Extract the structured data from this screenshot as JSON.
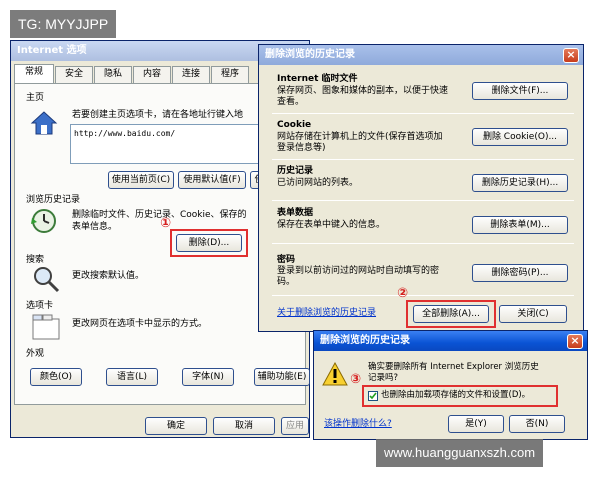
{
  "watermark": {
    "tag": "TG: MYYJJPP",
    "site": "www.huangguanxszh.com"
  },
  "inet": {
    "title": "Internet 选项",
    "tabs": [
      "常规",
      "安全",
      "隐私",
      "内容",
      "连接",
      "程序"
    ],
    "home": {
      "section": "主页",
      "desc": "若要创建主页选项卡，请在各地址行键入地",
      "url": "http://www.baidu.com/",
      "use_current": "使用当前页(C)",
      "use_default": "使用默认值(F)",
      "use_blank": "使"
    },
    "history": {
      "section": "浏览历史记录",
      "desc1": "删除临时文件、历史记录、Cookie、保存的",
      "desc2": "表单信息。",
      "delete_btn": "删除(D)..."
    },
    "search": {
      "section": "搜索",
      "desc": "更改搜索默认值。"
    },
    "tabs_sec": {
      "section": "选项卡",
      "desc": "更改网页在选项卡中显示的方式。"
    },
    "appearance": {
      "section": "外观",
      "buttons": [
        "颜色(O)",
        "语言(L)",
        "字体(N)",
        "辅助功能(E)"
      ]
    },
    "footer": {
      "ok": "确定",
      "cancel": "取消",
      "apply": "应用"
    }
  },
  "del": {
    "title": "删除浏览的历史记录",
    "rows": [
      {
        "title": "Internet 临时文件",
        "desc1": "保存网页、图象和媒体的副本，以便于快速",
        "desc2": "查看。",
        "btn": "删除文件(F)..."
      },
      {
        "title": "Cookie",
        "desc1": "网站存储在计算机上的文件(保存首选项加",
        "desc2": "登录信息等)",
        "btn": "删除 Cookie(O)..."
      },
      {
        "title": "历史记录",
        "desc1": "已访问网站的列表。",
        "desc2": "",
        "btn": "删除历史记录(H)..."
      },
      {
        "title": "表单数据",
        "desc1": "保存在表单中键入的信息。",
        "desc2": "",
        "btn": "删除表单(M)..."
      },
      {
        "title": "密码",
        "desc1": "登录到以前访问过的网站时自动填写的密",
        "desc2": "码。",
        "btn": "删除密码(P)..."
      }
    ],
    "about_link": "关于删除浏览的历史记录",
    "delete_all": "全部删除(A)...",
    "close": "关闭(C)"
  },
  "confirm": {
    "title": "删除浏览的历史记录",
    "q1": "确实要删除所有 Internet Explorer 浏览历史",
    "q2": "记录吗?",
    "checkbox_label": "也删除由加载项存储的文件和设置(D)。",
    "checked": true,
    "help_link": "该操作删除什么?",
    "yes": "是(Y)",
    "no": "否(N)"
  },
  "markers": [
    "①",
    "②",
    "③"
  ],
  "colors": {
    "highlight": "#e03030",
    "titlebar": "#0a53d4",
    "dialog_bg": "#ece9d8"
  }
}
